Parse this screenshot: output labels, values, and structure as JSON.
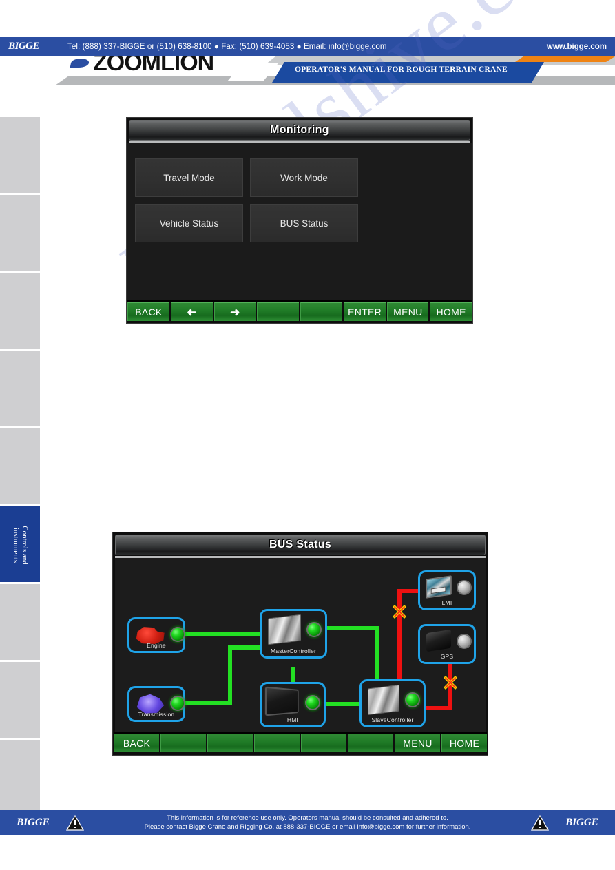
{
  "header": {
    "brand": "BIGGE",
    "contact": "Tel: (888) 337-BIGGE or (510) 638-8100  ●  Fax: (510) 639-4053  ●  Email: info@bigge.com",
    "website": "www.bigge.com"
  },
  "banner": {
    "logo_text": "ZOOMLION",
    "subtitle": "OPERATOR'S MANUAL FOR ROUGH TERRAIN CRANE"
  },
  "sidebar": {
    "items": [
      {
        "label": "",
        "active": false
      },
      {
        "label": "",
        "active": false
      },
      {
        "label": "",
        "active": false
      },
      {
        "label": "",
        "active": false
      },
      {
        "label": "",
        "active": false
      },
      {
        "label": "Controls and instruments",
        "active": true
      },
      {
        "label": "",
        "active": false
      },
      {
        "label": "",
        "active": false
      },
      {
        "label": "",
        "active": false
      }
    ]
  },
  "screen1": {
    "title": "Monitoring",
    "tiles": [
      {
        "label": "Travel Mode"
      },
      {
        "label": "Work Mode"
      },
      {
        "label": "Vehicle Status"
      },
      {
        "label": "BUS Status"
      }
    ],
    "keys": [
      {
        "label": "BACK",
        "icon": ""
      },
      {
        "label": "",
        "icon": "arrow-left-icon"
      },
      {
        "label": "",
        "icon": "arrow-right-icon"
      },
      {
        "label": "",
        "icon": ""
      },
      {
        "label": "",
        "icon": ""
      },
      {
        "label": "ENTER",
        "icon": ""
      },
      {
        "label": "MENU",
        "icon": ""
      },
      {
        "label": "HOME",
        "icon": ""
      }
    ]
  },
  "screen2": {
    "title": "BUS Status",
    "nodes": [
      {
        "id": "engine",
        "label": "Engine",
        "icon": "engine-icon",
        "status": "on"
      },
      {
        "id": "trans",
        "label": "Transmission",
        "icon": "transmission-icon",
        "status": "on"
      },
      {
        "id": "master",
        "label": "MasterController",
        "icon": "master-controller-icon",
        "status": "on"
      },
      {
        "id": "hmi",
        "label": "HMI",
        "icon": "hmi-display-icon",
        "status": "on"
      },
      {
        "id": "slave",
        "label": "SlaveController",
        "icon": "slave-controller-icon",
        "status": "on"
      },
      {
        "id": "lmi",
        "label": "LMI",
        "icon": "lmi-module-icon",
        "status": "off"
      },
      {
        "id": "gps",
        "label": "GPS",
        "icon": "gps-module-icon",
        "status": "off"
      }
    ],
    "links": [
      {
        "from": "engine",
        "to": "master",
        "state": "ok"
      },
      {
        "from": "trans",
        "to": "master",
        "state": "ok"
      },
      {
        "from": "master",
        "to": "hmi",
        "state": "ok"
      },
      {
        "from": "master",
        "to": "slave",
        "state": "ok"
      },
      {
        "from": "hmi",
        "to": "slave",
        "state": "ok"
      },
      {
        "from": "slave",
        "to": "lmi",
        "state": "fault"
      },
      {
        "from": "slave",
        "to": "gps",
        "state": "fault"
      }
    ],
    "keys": [
      {
        "label": "BACK"
      },
      {
        "label": ""
      },
      {
        "label": ""
      },
      {
        "label": ""
      },
      {
        "label": ""
      },
      {
        "label": ""
      },
      {
        "label": "MENU"
      },
      {
        "label": "HOME"
      }
    ]
  },
  "watermark": {
    "text": "manualshive.com"
  },
  "footer": {
    "brand_left": "BIGGE",
    "brand_right": "BIGGE",
    "line1": "This information is for reference use only. Operators manual should be consulted and adhered to.",
    "line2": "Please contact Bigge Crane and Rigging Co. at 888-337-BIGGE or email info@bigge.com for further information."
  },
  "colors": {
    "brand_blue": "#2b4ea2",
    "key_green": "#1f7a26",
    "node_border": "#1fa3e8",
    "link_ok": "#23e023",
    "link_fault": "#ee1111",
    "xmark": "#ff1a1a"
  }
}
